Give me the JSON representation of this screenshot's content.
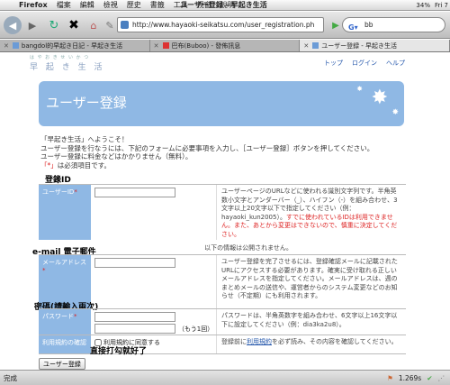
{
  "menubar": {
    "app": "Firefox",
    "items": [
      "檔案",
      "編輯",
      "檢視",
      "歷史",
      "書籤",
      "工具",
      "視窗",
      "說明"
    ],
    "window_title": "ユーザー登録 - 早起き生活",
    "battery": "34%",
    "clock": "Fri 7"
  },
  "toolbar": {
    "url": "http://www.hayaoki-seikatsu.com/user_registration.ph",
    "search": "bb"
  },
  "tabs": [
    {
      "label": "bangdol的早起き日記 - 早起き生活"
    },
    {
      "label": "巴布(Buboo) - 發佈訊息"
    },
    {
      "label": "ユーザー登録 - 早起き生活"
    }
  ],
  "page": {
    "logo_small": "は や お き せ い か つ",
    "logo_big": "早 起 き 生 活",
    "toplinks": [
      "トップ",
      "ログイン",
      "ヘルプ"
    ],
    "banner_title": "ユーザー登録",
    "intro": [
      "「早起き生活」へようこそ！",
      "ユーザー登録を行なうには、下記のフォームに必要事項を入力し、［ユーザー登録］ボタンを押してください。",
      "ユーザー登録に料金などはかかりません（無料）。"
    ],
    "req_mark": "「*」",
    "req_text": "は必須項目です。",
    "userid": {
      "label": "ユーザーID",
      "desc": "ユーザーページのURLなどに使われる識別文字列です。半角英数小文字とアンダーバー（_）、ハイフン（-）を組み合わせ、3文字以上20文字以下で指定してください（例：hayaoki_kun2005）。",
      "desc_red": "すでに使われているIDは利用できません。また、あとから変更はできないので、慎重に決定してください。"
    },
    "notice": "以下の情報は公開されません。",
    "email": {
      "label": "メールアドレス",
      "desc": "ユーザー登録を完了させるには、登録確認メールに記載されたURLにアクセスする必要があります。確実に受け取れる正しいメールアドレスを指定してください。メールアドレスは、週のまとめメールの送信や、運営者からのシステム変更などのお知らせ（不定期）にも利用されます。"
    },
    "password": {
      "label": "パスワード",
      "confirm_label": "（もう1回）",
      "desc": "パスワードは、半角英数字を組み合わせ、6文字以上16文字以下に設定してください（例：dia3ka2u8）。"
    },
    "terms": {
      "label": "利用規約の確認",
      "checkbox_label": "利用規約に同意する",
      "desc_pre": "登録前に",
      "desc_link": "利用規約",
      "desc_post": "を必ず読み、その内容を確認してください。"
    },
    "submit": "ユーザー登録"
  },
  "annotations": {
    "userid": "登錄ID",
    "email": "e-mail 電子郵件",
    "password": "密碼(請輸入兩次)",
    "terms": "直接打勾就好了"
  },
  "statusbar": {
    "text": "完成",
    "time": "1.269s"
  }
}
